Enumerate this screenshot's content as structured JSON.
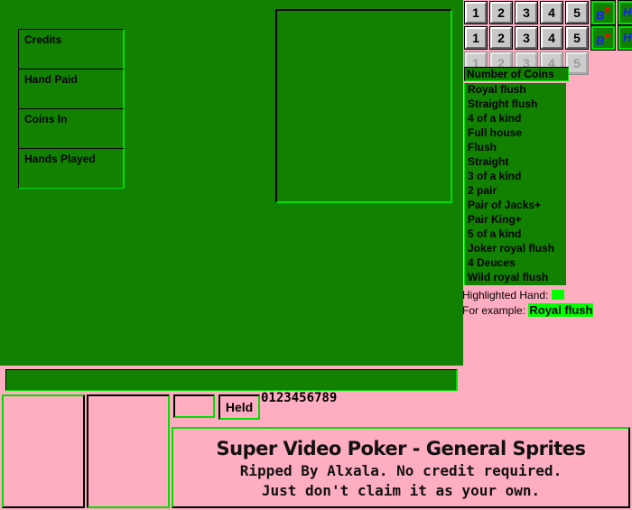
{
  "colors": {
    "background_pink": "#ffadc1",
    "panel_green": "#128000",
    "bevel_bright_green": "#00e000",
    "highlight_green": "#00ff00",
    "bevel_black": "#000000",
    "button_gray": "#c7c7c7",
    "button_disabled_text": "#9a9a9a",
    "letter_blue": "#1a1aff",
    "letter_red": "#ff0000"
  },
  "meters": {
    "items": [
      {
        "label": "Credits"
      },
      {
        "label": "Hand Paid"
      },
      {
        "label": "Coins In"
      },
      {
        "label": "Hands Played"
      }
    ]
  },
  "coin_buttons": {
    "rows": [
      {
        "state": "normal",
        "labels": [
          "1",
          "2",
          "3",
          "4",
          "5"
        ]
      },
      {
        "state": "normal",
        "labels": [
          "1",
          "2",
          "3",
          "4",
          "5"
        ]
      },
      {
        "state": "disabled",
        "labels": [
          "1",
          "2",
          "3",
          "4",
          "5"
        ]
      }
    ],
    "side_buttons": [
      {
        "row": 0,
        "bp": "BP",
        "hp": "HP"
      },
      {
        "row": 1,
        "bp": "BP",
        "hp": "HP"
      }
    ]
  },
  "paytable": {
    "header": "Number of Coins",
    "hands": [
      "Royal flush",
      "Straight flush",
      "4 of a kind",
      "Full house",
      "Flush",
      "Straight",
      "3 of a kind",
      "2 pair",
      "Pair of Jacks+",
      "Pair King+",
      "5 of a kind",
      "Joker royal flush",
      "4 Deuces",
      "Wild royal flush"
    ]
  },
  "highlight": {
    "hand_label": "Highlighted Hand:",
    "example_label": "For example:",
    "example_value": "Royal flush"
  },
  "controls": {
    "held_label": "Held",
    "digits": "0123456789"
  },
  "credit": {
    "title": "Super Video Poker - General Sprites",
    "line2": "Ripped By Alxala. No credit required.",
    "line3": "Just don't claim it as your own."
  }
}
